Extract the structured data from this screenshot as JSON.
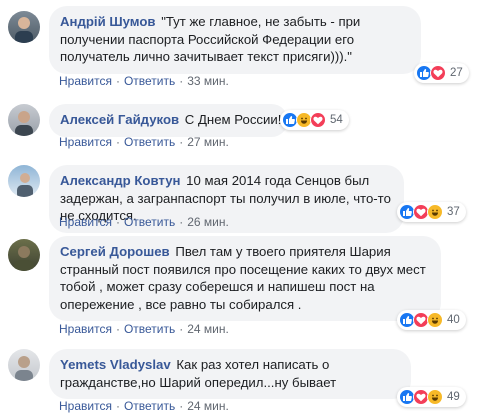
{
  "comments": [
    {
      "author": "Андрій Шумов",
      "text": "\"Тут же главное, не забыть - при получении паспорта Российской Федерации его получатель лично зачитывает текст присяги))).\"",
      "actions": [
        "Нравится",
        "Ответить"
      ],
      "time": "33 мин.",
      "reactions": [
        "like",
        "love"
      ],
      "count": "27"
    },
    {
      "author": "Алексей Гайдуков",
      "text": "С Днем России!",
      "actions": [
        "Нравится",
        "Ответить"
      ],
      "time": "27 мин.",
      "reactions": [
        "like",
        "haha",
        "love"
      ],
      "count": "54"
    },
    {
      "author": "Александр Ковтун",
      "text": "10 мая 2014 года Сенцов был задержан, а загранпаспорт ты получил в июле, что-то не сходится.",
      "actions": [
        "Нравится",
        "Ответить"
      ],
      "time": "26 мин.",
      "reactions": [
        "like",
        "love",
        "haha"
      ],
      "count": "37"
    },
    {
      "author": "Сергей Дорошев",
      "text": "Пвел там у твоего приятеля Шария странный пост появился про посещение каких то двух мест тобой , может сразу соберешся и напишеш пост на опережение , все равно ты собирался .",
      "actions": [
        "Нравится",
        "Ответить"
      ],
      "time": "24 мин.",
      "reactions": [
        "like",
        "love",
        "haha"
      ],
      "count": "40"
    },
    {
      "author": "Yemets Vladyslav",
      "text": "Как раз хотел написать о гражданстве,но Шарий опередил...ну бывает",
      "actions": [
        "Нравится",
        "Ответить"
      ],
      "time": "24 мин.",
      "reactions": [
        "like",
        "love",
        "haha"
      ],
      "count": "49"
    }
  ],
  "colors": {
    "author": "#385898",
    "bubble": "#f2f3f5",
    "meta": "#616770",
    "like": "#1877f2",
    "love": "#f33e58",
    "haha": "#f7b928"
  }
}
